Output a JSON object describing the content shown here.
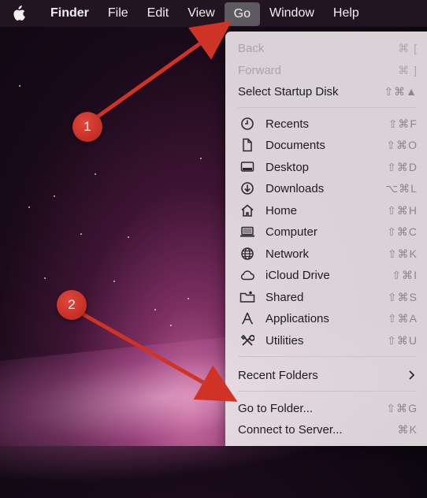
{
  "menubar": {
    "app_name": "Finder",
    "items": [
      "File",
      "Edit",
      "View",
      "Go",
      "Window",
      "Help"
    ],
    "active": "Go"
  },
  "go_menu": {
    "top": [
      {
        "label": "Back",
        "shortcut": "⌘ [",
        "disabled": true
      },
      {
        "label": "Forward",
        "shortcut": "⌘ ]",
        "disabled": true
      },
      {
        "label": "Select Startup Disk",
        "shortcut": "⇧⌘▲",
        "disabled": false
      }
    ],
    "places": [
      {
        "label": "Recents",
        "shortcut": "⇧⌘F",
        "icon": "clock-icon"
      },
      {
        "label": "Documents",
        "shortcut": "⇧⌘O",
        "icon": "document-icon"
      },
      {
        "label": "Desktop",
        "shortcut": "⇧⌘D",
        "icon": "desktop-icon"
      },
      {
        "label": "Downloads",
        "shortcut": "⌥⌘L",
        "icon": "download-icon"
      },
      {
        "label": "Home",
        "shortcut": "⇧⌘H",
        "icon": "home-icon"
      },
      {
        "label": "Computer",
        "shortcut": "⇧⌘C",
        "icon": "laptop-icon"
      },
      {
        "label": "Network",
        "shortcut": "⇧⌘K",
        "icon": "globe-icon"
      },
      {
        "label": "iCloud Drive",
        "shortcut": "⇧⌘I",
        "icon": "cloud-icon"
      },
      {
        "label": "Shared",
        "shortcut": "⇧⌘S",
        "icon": "shared-folder-icon"
      },
      {
        "label": "Applications",
        "shortcut": "⇧⌘A",
        "icon": "applications-icon"
      },
      {
        "label": "Utilities",
        "shortcut": "⇧⌘U",
        "icon": "utilities-icon"
      }
    ],
    "recent_folders": {
      "label": "Recent Folders"
    },
    "bottom": [
      {
        "label": "Go to Folder...",
        "shortcut": "⇧⌘G"
      },
      {
        "label": "Connect to Server...",
        "shortcut": "⌘K"
      }
    ]
  },
  "annotations": {
    "badge_1": "1",
    "badge_2": "2",
    "color": "#cf3325"
  }
}
